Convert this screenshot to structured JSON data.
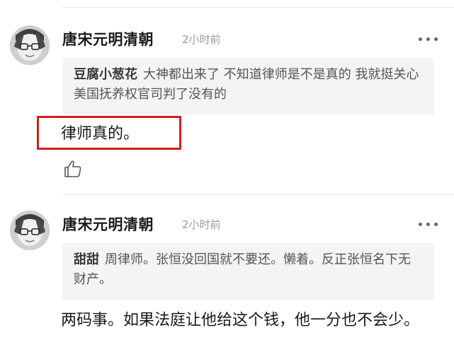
{
  "comments": [
    {
      "username": "唐宋元明清朝",
      "time": "2小时前",
      "quote_author": "豆腐小葱花",
      "quote_text": "大神都出来了 不知道律师是不是真的 我就挺关心美国抚养权官司判了没有的",
      "text": "律师真的。"
    },
    {
      "username": "唐宋元明清朝",
      "time": "2小时前",
      "quote_author": "甜甜",
      "quote_text": "周律师。张恒没回国就不要还。懒着。反正张恒名下无财产。",
      "text": "两码事。如果法庭让他给这个钱，他一分也不会少。"
    }
  ],
  "colors": {
    "highlight": "#d51c1c",
    "quote_bg": "#f4f4f4",
    "time": "#9a9a9a"
  },
  "icons": {
    "more": "more-dots-icon",
    "like": "thumbs-up-icon"
  }
}
